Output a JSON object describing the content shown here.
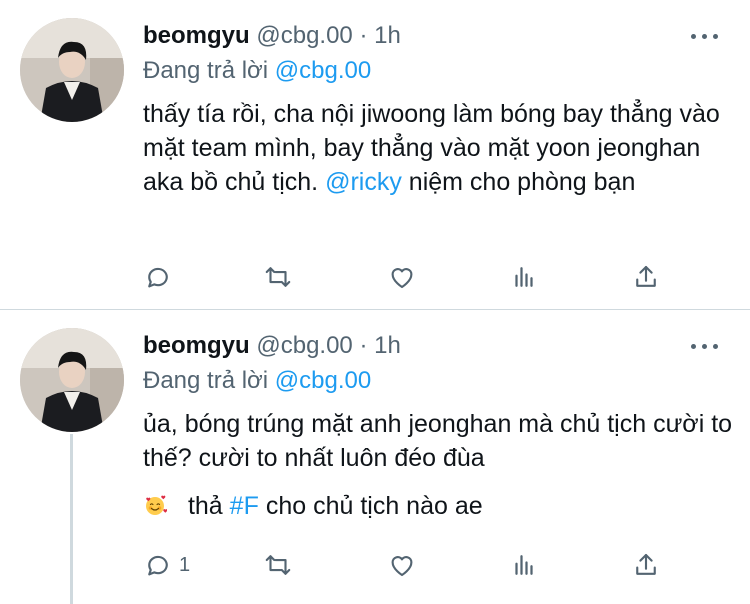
{
  "tweets": [
    {
      "author_name": "beomgyu",
      "author_handle": "@cbg.00",
      "separator": "·",
      "time": "1h",
      "replying_prefix": "Đang trả lời",
      "replying_to": "@cbg.00",
      "text_part1": "thấy tía rồi, cha nội jiwoong làm bóng bay thẳng vào mặt team mình, bay thẳng vào mặt yoon jeonghan aka bồ chủ tịch.",
      "text_mention": "@ricky",
      "text_part2": "niệm cho phòng bạn",
      "reply_count": "",
      "icons": [
        "reply-icon",
        "retweet-icon",
        "like-icon",
        "analytics-icon",
        "share-icon",
        "more-icon"
      ]
    },
    {
      "author_name": "beomgyu",
      "author_handle": "@cbg.00",
      "separator": "·",
      "time": "1h",
      "replying_prefix": "Đang trả lời",
      "replying_to": "@cbg.00",
      "text_line1": "ủa, bóng trúng mặt anh jeonghan mà chủ tịch cười to thế? cười to nhất luôn đéo đùa",
      "emoji": "smiling-face-with-hearts-emoji",
      "text_line2_prefix": "thả",
      "hashtag": "#F",
      "text_line2_suffix": "cho chủ tịch nào ae",
      "reply_count": "1",
      "icons": [
        "reply-icon",
        "retweet-icon",
        "like-icon",
        "analytics-icon",
        "share-icon",
        "more-icon"
      ]
    }
  ],
  "colors": {
    "text": "#0f1419",
    "secondary": "#536471",
    "link": "#1d9bf0",
    "divider": "#cfd9de"
  }
}
